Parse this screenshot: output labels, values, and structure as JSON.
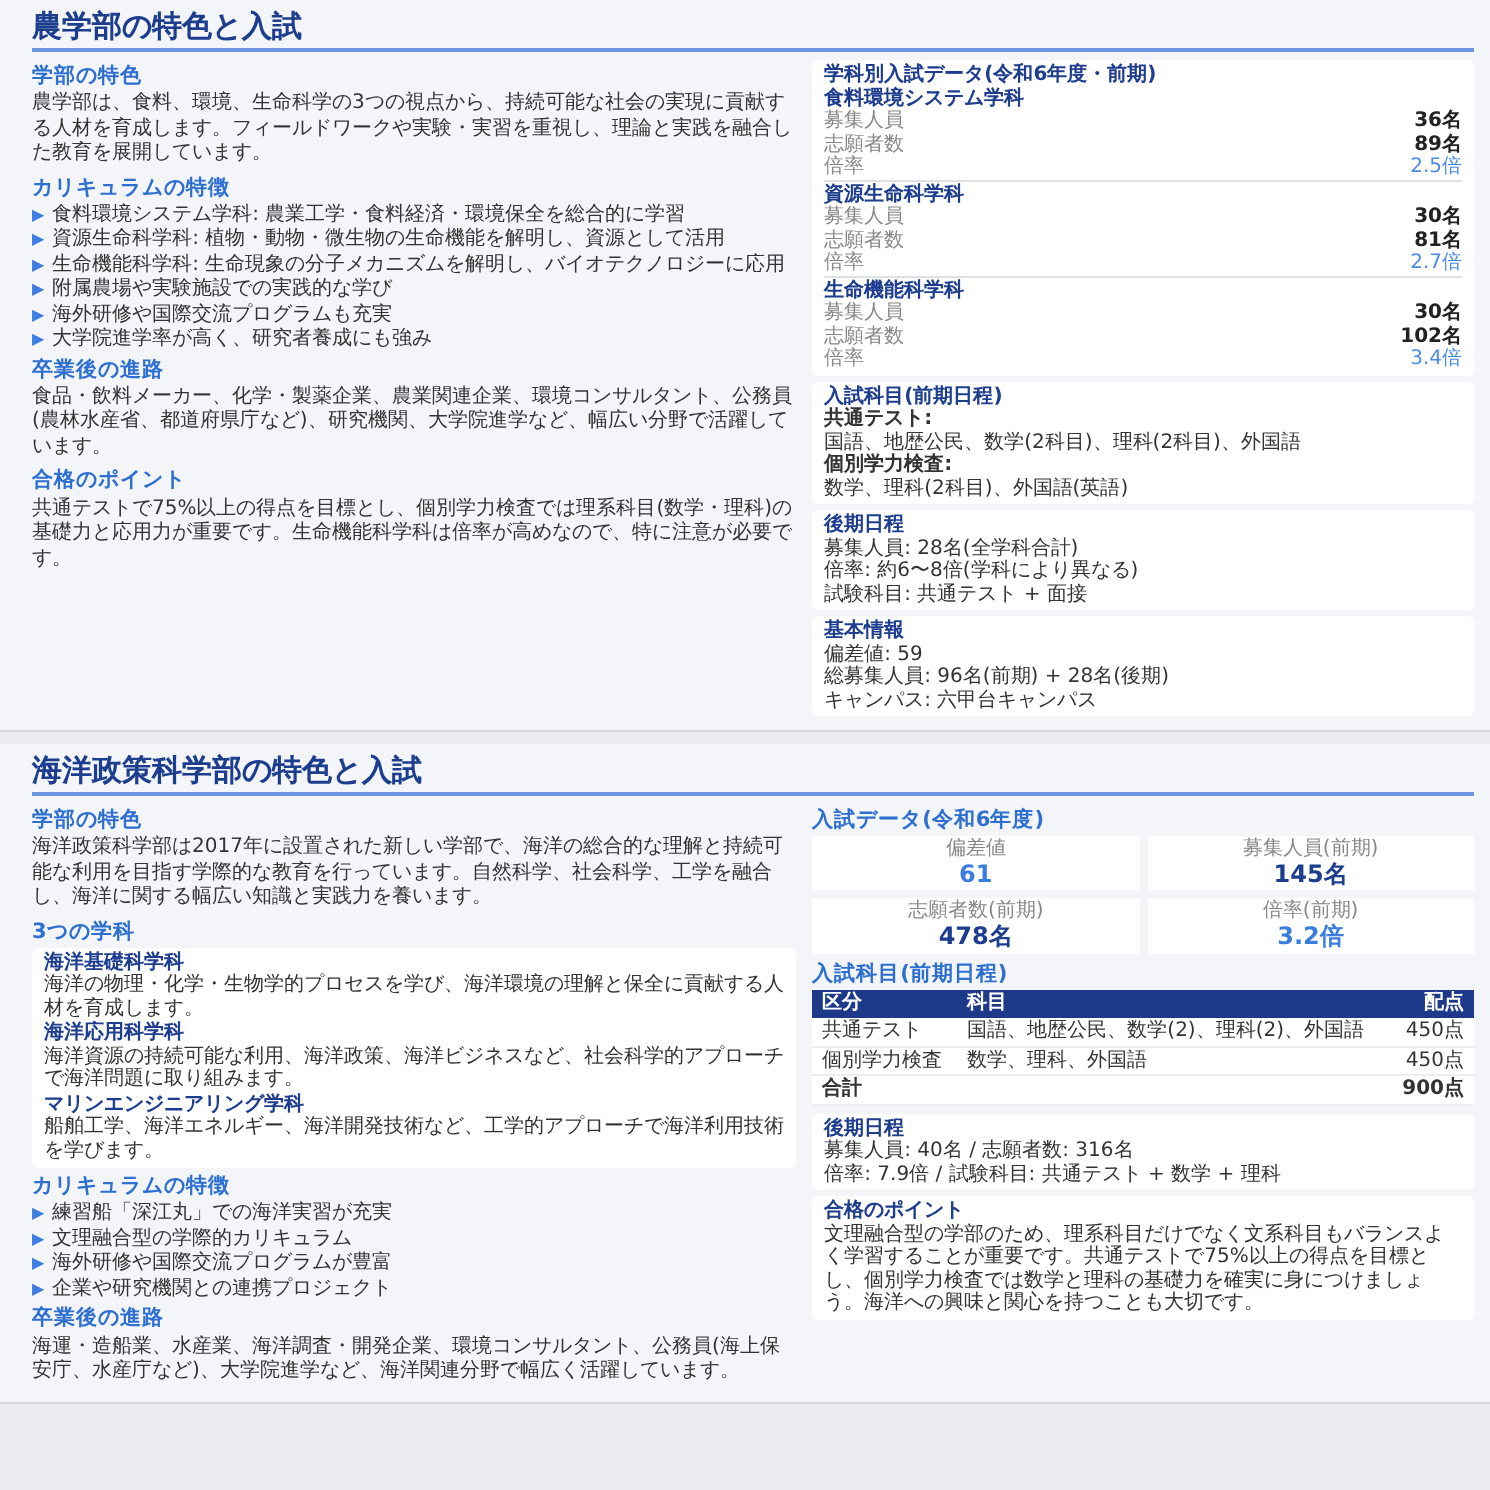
{
  "sections": [
    {
      "title": "農学部の特色と入試",
      "left": [
        {
          "kind": "text",
          "heading": "学部の特色",
          "text": "農学部は、食料、環境、生命科学の3つの視点から、持続可能な社会の実現に貢献する人材を育成します。フィールドワークや実験・実習を重視し、理論と実践を融合した教育を展開しています。"
        },
        {
          "kind": "list",
          "heading": "カリキュラムの特徴",
          "bullet": "▶",
          "items": [
            "食料環境システム学科: 農業工学・食料経済・環境保全を総合的に学習",
            "資源生命科学科: 植物・動物・微生物の生命機能を解明し、資源として活用",
            "生命機能科学科: 生命現象の分子メカニズムを解明し、バイオテクノロジーに応用",
            "附属農場や実験施設での実践的な学び",
            "海外研修や国際交流プログラムも充実",
            "大学院進学率が高く、研究者養成にも強み"
          ]
        },
        {
          "kind": "text",
          "heading": "卒業後の進路",
          "text": "食品・飲料メーカー、化学・製薬企業、農業関連企業、環境コンサルタント、公務員(農林水産省、都道府県庁など)、研究機関、大学院進学など、幅広い分野で活躍しています。"
        },
        {
          "kind": "text",
          "heading": "合格のポイント",
          "text": "共通テストで75%以上の得点を目標とし、個別学力検査では理系科目(数学・理科)の基礎力と応用力が重要です。生命機能科学科は倍率が高めなので、特に注意が必要です。"
        }
      ],
      "right": [
        {
          "kind": "departments",
          "heading": "学科別入試データ(令和6年度・前期)",
          "departments": [
            {
              "name": "食料環境システム学科",
              "rows": [
                {
                  "label": "募集人員",
                  "value": "36名",
                  "kind": "count"
                },
                {
                  "label": "志願者数",
                  "value": "89名",
                  "kind": "count"
                },
                {
                  "label": "倍率",
                  "value": "2.5倍",
                  "kind": "ratio"
                }
              ]
            },
            {
              "name": "資源生命科学科",
              "rows": [
                {
                  "label": "募集人員",
                  "value": "30名",
                  "kind": "count"
                },
                {
                  "label": "志願者数",
                  "value": "81名",
                  "kind": "count"
                },
                {
                  "label": "倍率",
                  "value": "2.7倍",
                  "kind": "ratio"
                }
              ]
            },
            {
              "name": "生命機能科学科",
              "rows": [
                {
                  "label": "募集人員",
                  "value": "30名",
                  "kind": "count"
                },
                {
                  "label": "志願者数",
                  "value": "102名",
                  "kind": "count"
                },
                {
                  "label": "倍率",
                  "value": "3.4倍",
                  "kind": "ratio"
                }
              ]
            }
          ]
        },
        {
          "kind": "subjects",
          "heading": "入試科目(前期日程)",
          "groups": [
            {
              "label": "共通テスト:",
              "text": "国語、地歴公民、数学(2科目)、理科(2科目)、外国語"
            },
            {
              "label": "個別学力検査:",
              "text": "数学、理科(2科目)、外国語(英語)"
            }
          ]
        },
        {
          "kind": "lines",
          "heading": "後期日程",
          "lines": [
            "募集人員: 28名(全学科合計)",
            "倍率: 約6〜8倍(学科により異なる)",
            "試験科目: 共通テスト + 面接"
          ]
        },
        {
          "kind": "lines",
          "heading": "基本情報",
          "lines": [
            "偏差値: 59",
            "総募集人員: 96名(前期) + 28名(後期)",
            "キャンパス: 六甲台キャンパス"
          ]
        }
      ]
    },
    {
      "title": "海洋政策科学部の特色と入試",
      "left": [
        {
          "kind": "text",
          "heading": "学部の特色",
          "text": "海洋政策科学部は2017年に設置された新しい学部で、海洋の総合的な理解と持続可能な利用を目指す学際的な教育を行っています。自然科学、社会科学、工学を融合し、海洋に関する幅広い知識と実践力を養います。"
        },
        {
          "kind": "majors",
          "heading": "3つの学科",
          "majors": [
            {
              "name": "海洋基礎科学科",
              "text": "海洋の物理・化学・生物学的プロセスを学び、海洋環境の理解と保全に貢献する人材を育成します。"
            },
            {
              "name": "海洋応用科学科",
              "text": "海洋資源の持続可能な利用、海洋政策、海洋ビジネスなど、社会科学的アプローチで海洋問題に取り組みます。"
            },
            {
              "name": "マリンエンジニアリング学科",
              "text": "船舶工学、海洋エネルギー、海洋開発技術など、工学的アプローチで海洋利用技術を学びます。"
            }
          ]
        },
        {
          "kind": "list",
          "heading": "カリキュラムの特徴",
          "bullet": "▶",
          "items": [
            "練習船「深江丸」での海洋実習が充実",
            "文理融合型の学際的カリキュラム",
            "海外研修や国際交流プログラムが豊富",
            "企業や研究機関との連携プロジェクト"
          ]
        },
        {
          "kind": "text",
          "heading": "卒業後の進路",
          "text": "海運・造船業、水産業、海洋調査・開発企業、環境コンサルタント、公務員(海上保安庁、水産庁など)、大学院進学など、海洋関連分野で幅広く活躍しています。"
        }
      ],
      "right": [
        {
          "kind": "stats",
          "heading": "入試データ(令和6年度)",
          "stats": [
            {
              "label": "偏差値",
              "value": "61",
              "kind": "ratio"
            },
            {
              "label": "募集人員(前期)",
              "value": "145名",
              "kind": "count"
            },
            {
              "label": "志願者数(前期)",
              "value": "478名",
              "kind": "count"
            },
            {
              "label": "倍率(前期)",
              "value": "3.2倍",
              "kind": "ratio"
            }
          ]
        },
        {
          "kind": "table",
          "heading": "入試科目(前期日程)",
          "columns": [
            "区分",
            "科目",
            "配点"
          ],
          "rows": [
            {
              "kind": "normal",
              "cells": [
                "共通テスト",
                "国語、地歴公民、数学(2)、理科(2)、外国語",
                "450点"
              ]
            },
            {
              "kind": "normal",
              "cells": [
                "個別学力検査",
                "数学、理科、外国語",
                "450点"
              ]
            },
            {
              "kind": "total",
              "cells": [
                "合計",
                "",
                "900点"
              ]
            }
          ]
        },
        {
          "kind": "lines",
          "heading": "後期日程",
          "lines": [
            "募集人員: 40名 / 志願者数: 316名",
            "倍率: 7.9倍 / 試験科目: 共通テスト + 数学 + 理科"
          ]
        },
        {
          "kind": "lines",
          "heading": "合格のポイント",
          "lines": [
            "文理融合型の学部のため、理系科目だけでなく文系科目もバランスよく学習することが重要です。共通テストで75%以上の得点を目標とし、個別学力検査では数学と理科の基礎力を確実に身につけましょう。海洋への興味と関心を持つことも大切です。"
          ]
        }
      ]
    }
  ]
}
